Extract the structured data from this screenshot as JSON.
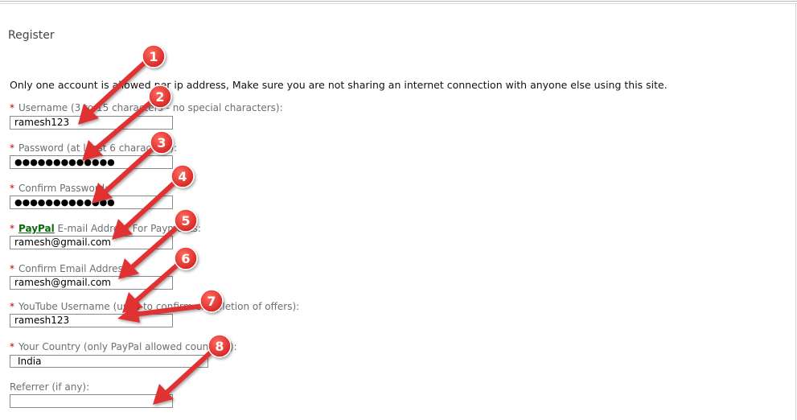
{
  "page": {
    "title": "Register",
    "notice": "Only one account is allowed per ip address, Make sure you are not sharing an internet connection with anyone else using this site."
  },
  "form": {
    "required_marker": "*",
    "username": {
      "label": "Username (3 to 15 characters - no special characters):",
      "value": "ramesh123"
    },
    "password": {
      "label": "Password (at least 6 characters):",
      "value": "●●●●●●●●●●●●●"
    },
    "confirm_password": {
      "label": "Confirm Password:",
      "value": "●●●●●●●●●●●●●"
    },
    "paypal_email": {
      "link": "PayPal",
      "label": " E-mail Address For Payments:",
      "value": "ramesh@gmail.com"
    },
    "confirm_email": {
      "label": "Confirm Email Address:",
      "value": "ramesh@gmail.com"
    },
    "youtube": {
      "label": "YouTube Username (used to confirm completion of offers):",
      "value": "ramesh123"
    },
    "country": {
      "label": "Your Country (only PayPal allowed countries):",
      "value": "India"
    },
    "referrer": {
      "label": "Referrer (if any):",
      "value": ""
    }
  },
  "annotations": {
    "color": "#e03030",
    "numbers": [
      "1",
      "2",
      "3",
      "4",
      "5",
      "6",
      "7",
      "8"
    ]
  }
}
